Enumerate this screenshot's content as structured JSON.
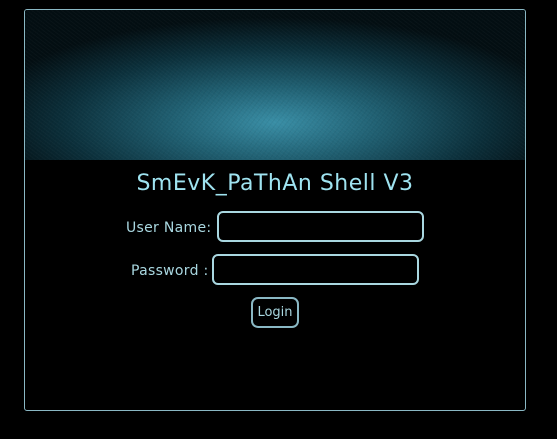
{
  "app": {
    "title": "SmEvK_PaThAn Shell V3"
  },
  "login_form": {
    "username_label": "User Name:",
    "username_value": "",
    "password_label": "Password :",
    "password_value": "",
    "login_button_label": "Login"
  },
  "colors": {
    "accent": "#9fe3f0",
    "border": "#a9d7e0",
    "background": "#000000",
    "banner": "#2b7f93"
  }
}
